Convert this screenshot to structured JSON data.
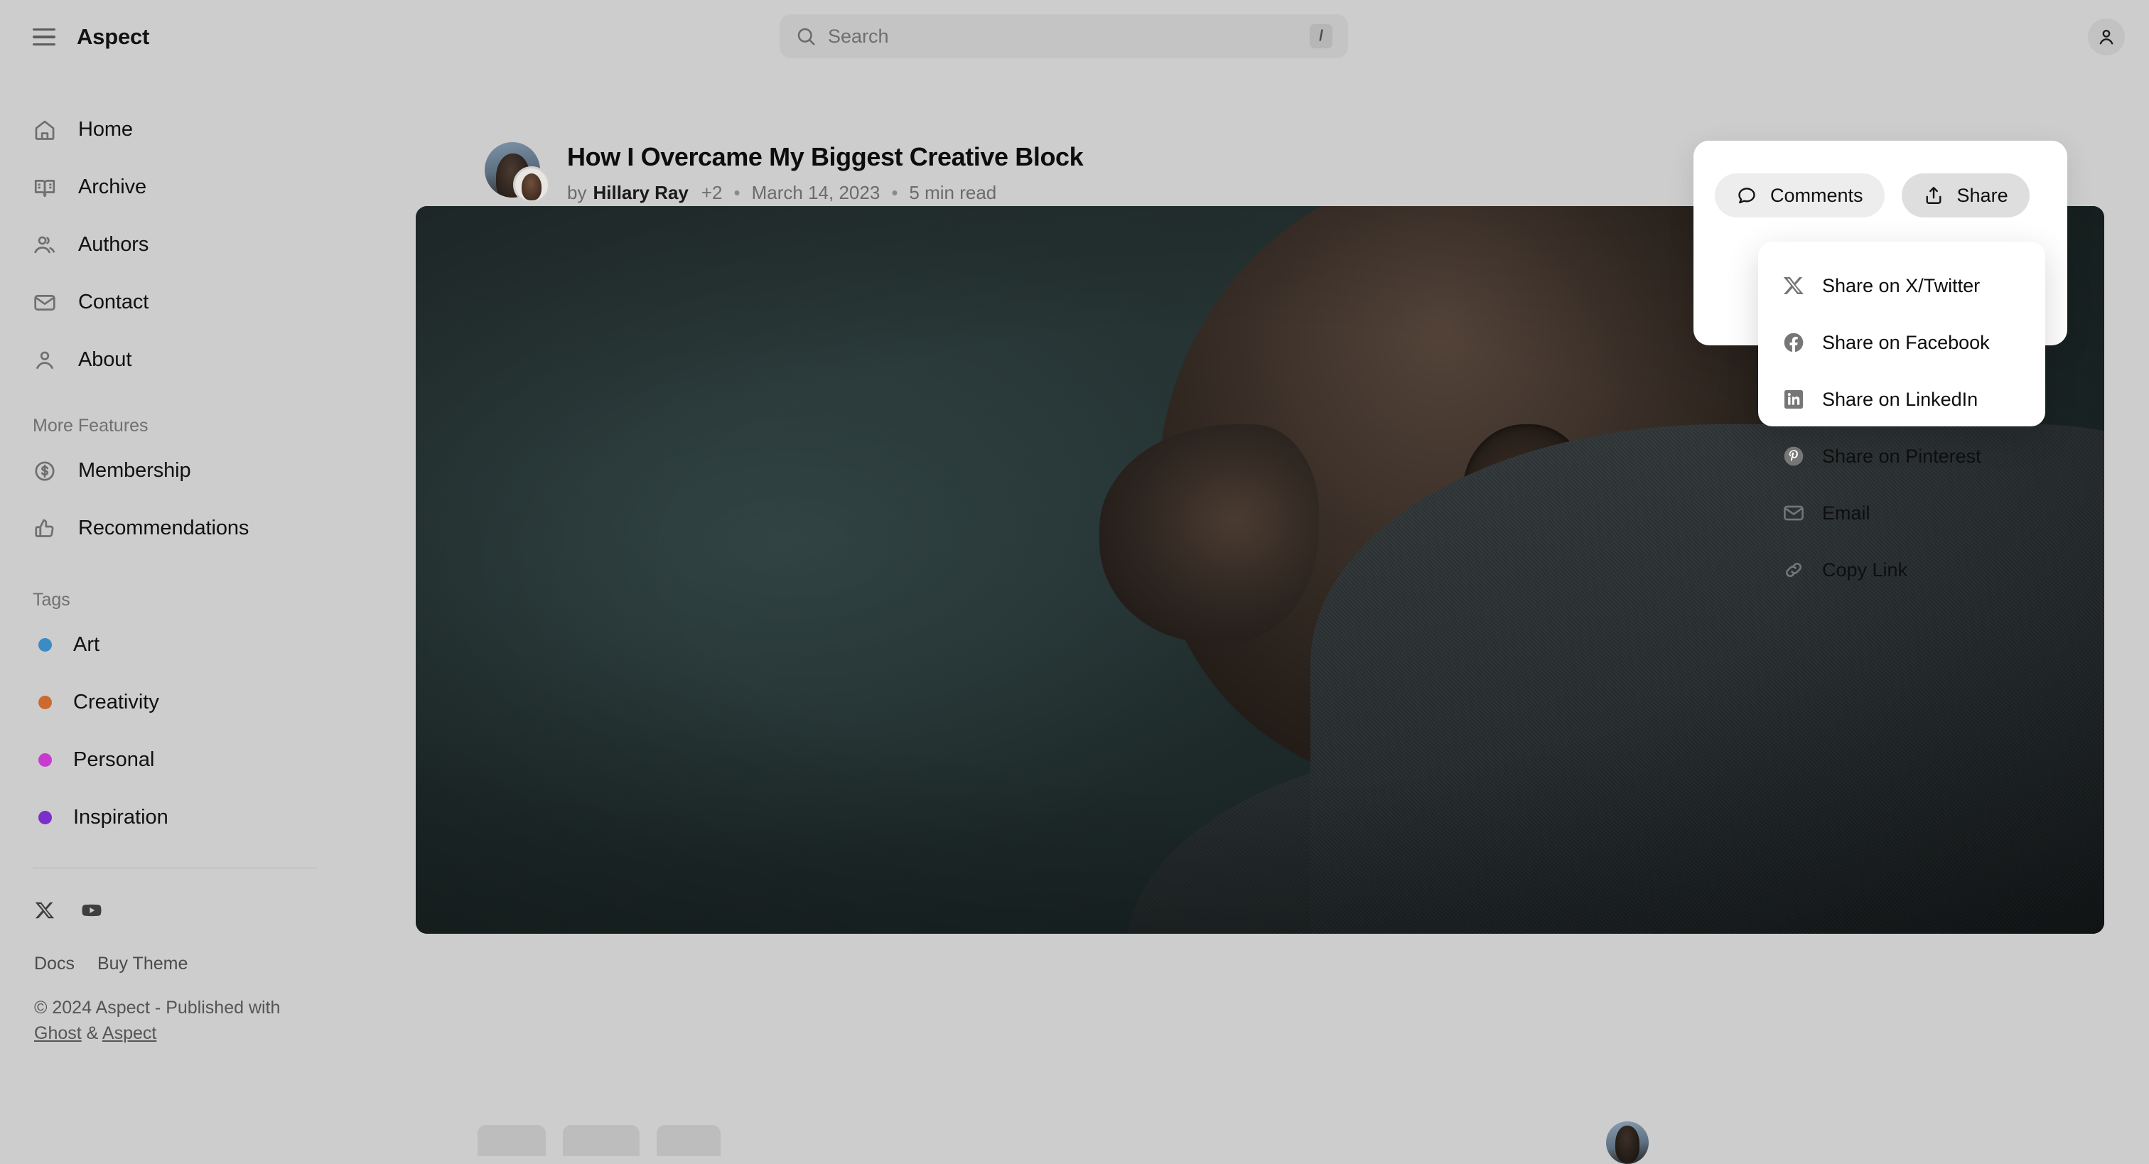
{
  "topbar": {
    "menu_icon": "hamburger-icon",
    "brand": "Aspect",
    "search": {
      "icon": "search-icon",
      "placeholder": "Search",
      "shortcut": "/"
    },
    "account_icon": "user-icon"
  },
  "sidebar": {
    "nav": [
      {
        "label": "Home",
        "icon": "home-icon"
      },
      {
        "label": "Archive",
        "icon": "book-open-icon"
      },
      {
        "label": "Authors",
        "icon": "users-icon"
      },
      {
        "label": "Contact",
        "icon": "mail-icon"
      },
      {
        "label": "About",
        "icon": "user-icon"
      }
    ],
    "more_features_heading": "More Features",
    "features": [
      {
        "label": "Membership",
        "icon": "dollar-circle-icon"
      },
      {
        "label": "Recommendations",
        "icon": "thumbs-up-icon"
      }
    ],
    "tags_heading": "Tags",
    "tags": [
      {
        "label": "Art",
        "color": "#3b8bc4"
      },
      {
        "label": "Creativity",
        "color": "#cc6a2e"
      },
      {
        "label": "Personal",
        "color": "#c73bd0"
      },
      {
        "label": "Inspiration",
        "color": "#7b2ecc"
      }
    ],
    "socials": [
      {
        "name": "x-twitter-icon"
      },
      {
        "name": "youtube-icon"
      }
    ],
    "footer_links": [
      {
        "label": "Docs"
      },
      {
        "label": "Buy Theme"
      }
    ],
    "copyright": {
      "prefix": "© 2024 Aspect - Published with ",
      "link1": "Ghost",
      "middle": " & ",
      "link2": "Aspect"
    }
  },
  "article": {
    "title": "How I Overcame My Biggest Creative Block",
    "meta": {
      "by": "by",
      "author": "Hillary Ray",
      "extra_authors": "+2",
      "sep1": "•",
      "date": "March 14, 2023",
      "sep2": "•",
      "read_time": "5 min read"
    }
  },
  "share_card": {
    "comments_label": "Comments",
    "comments_icon": "comment-bubble-icon",
    "share_label": "Share",
    "share_icon": "share-upload-icon"
  },
  "share_menu": {
    "items": [
      {
        "label": "Share on X/Twitter",
        "icon": "x-twitter-icon"
      },
      {
        "label": "Share on Facebook",
        "icon": "facebook-icon"
      },
      {
        "label": "Share on LinkedIn",
        "icon": "linkedin-icon"
      },
      {
        "label": "Share on Pinterest",
        "icon": "pinterest-icon"
      },
      {
        "label": "Email",
        "icon": "mail-icon"
      },
      {
        "label": "Copy Link",
        "icon": "link-icon"
      }
    ]
  },
  "colors": {
    "page_bg": "#cdcdcd",
    "card_bg": "#ffffff",
    "hero_bg": "#232f2f",
    "text_primary": "#111111",
    "text_muted": "#6e6e6e"
  }
}
